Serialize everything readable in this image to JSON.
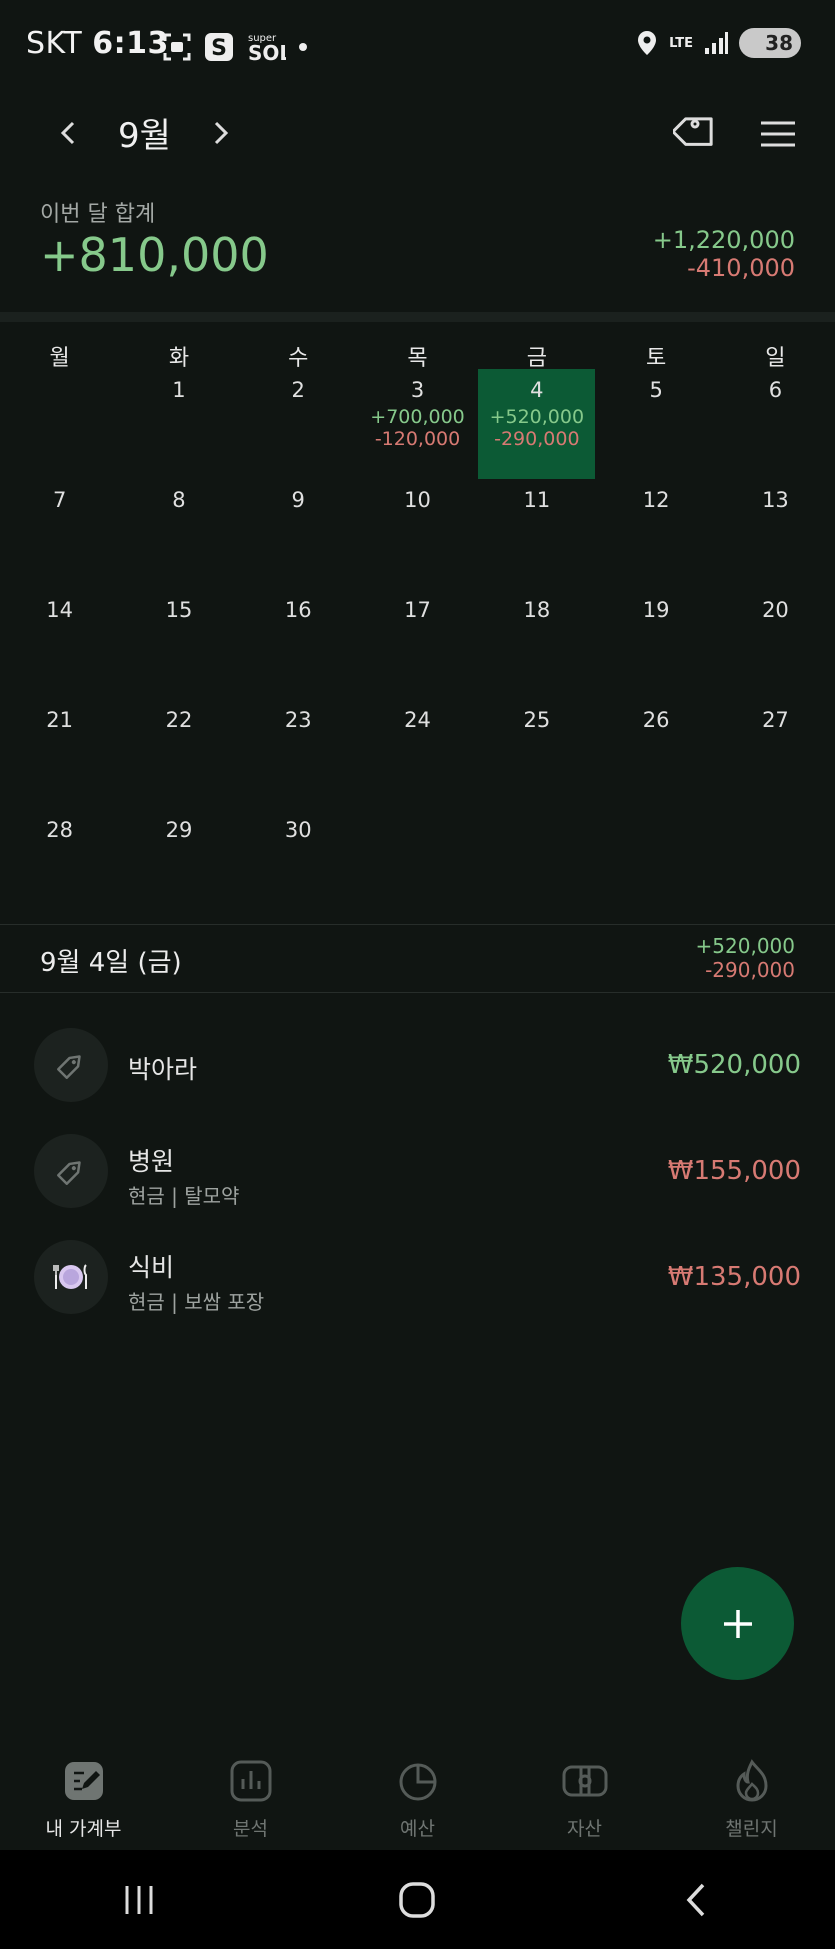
{
  "status_bar": {
    "carrier": "SKT",
    "time": "6:13",
    "network": "LTE",
    "battery": "38"
  },
  "header": {
    "month": "9월",
    "summary_label": "이번 달 합계",
    "summary_total": "+810,000",
    "summary_income": "+1,220,000",
    "summary_expense": "-410,000"
  },
  "calendar": {
    "weekdays": [
      "월",
      "화",
      "수",
      "목",
      "금",
      "토",
      "일"
    ],
    "days": [
      {
        "d": ""
      },
      {
        "d": "1"
      },
      {
        "d": "2"
      },
      {
        "d": "3",
        "in": "+700,000",
        "out": "-120,000"
      },
      {
        "d": "4",
        "in": "+520,000",
        "out": "-290,000",
        "selected": true
      },
      {
        "d": "5"
      },
      {
        "d": "6"
      },
      {
        "d": "7"
      },
      {
        "d": "8"
      },
      {
        "d": "9"
      },
      {
        "d": "10"
      },
      {
        "d": "11"
      },
      {
        "d": "12"
      },
      {
        "d": "13"
      },
      {
        "d": "14"
      },
      {
        "d": "15"
      },
      {
        "d": "16"
      },
      {
        "d": "17"
      },
      {
        "d": "18"
      },
      {
        "d": "19"
      },
      {
        "d": "20"
      },
      {
        "d": "21"
      },
      {
        "d": "22"
      },
      {
        "d": "23"
      },
      {
        "d": "24"
      },
      {
        "d": "25"
      },
      {
        "d": "26"
      },
      {
        "d": "27"
      },
      {
        "d": "28"
      },
      {
        "d": "29"
      },
      {
        "d": "30"
      }
    ]
  },
  "selected_day": {
    "label": "9월 4일 (금)",
    "income": "+520,000",
    "expense": "-290,000"
  },
  "transactions": [
    {
      "title": "박아라",
      "subtitle": "",
      "amount": "₩520,000",
      "type": "income",
      "icon": "tag-icon"
    },
    {
      "title": "병원",
      "subtitle": "현금 | 탈모약",
      "amount": "₩155,000",
      "type": "expense",
      "icon": "tag-icon"
    },
    {
      "title": "식비",
      "subtitle": "현금 | 보쌈 포장",
      "amount": "₩135,000",
      "type": "expense",
      "icon": "plate-icon"
    }
  ],
  "tabs": [
    {
      "label": "내 가계부",
      "icon": "ledger-icon",
      "active": true
    },
    {
      "label": "분석",
      "icon": "bar-chart-icon"
    },
    {
      "label": "예산",
      "icon": "pie-icon"
    },
    {
      "label": "자산",
      "icon": "wallet-icon"
    },
    {
      "label": "챌린지",
      "icon": "flame-icon"
    }
  ],
  "colors": {
    "income": "#86c98b",
    "expense": "#d77a73",
    "accent": "#0c5a35",
    "background": "#101512"
  }
}
